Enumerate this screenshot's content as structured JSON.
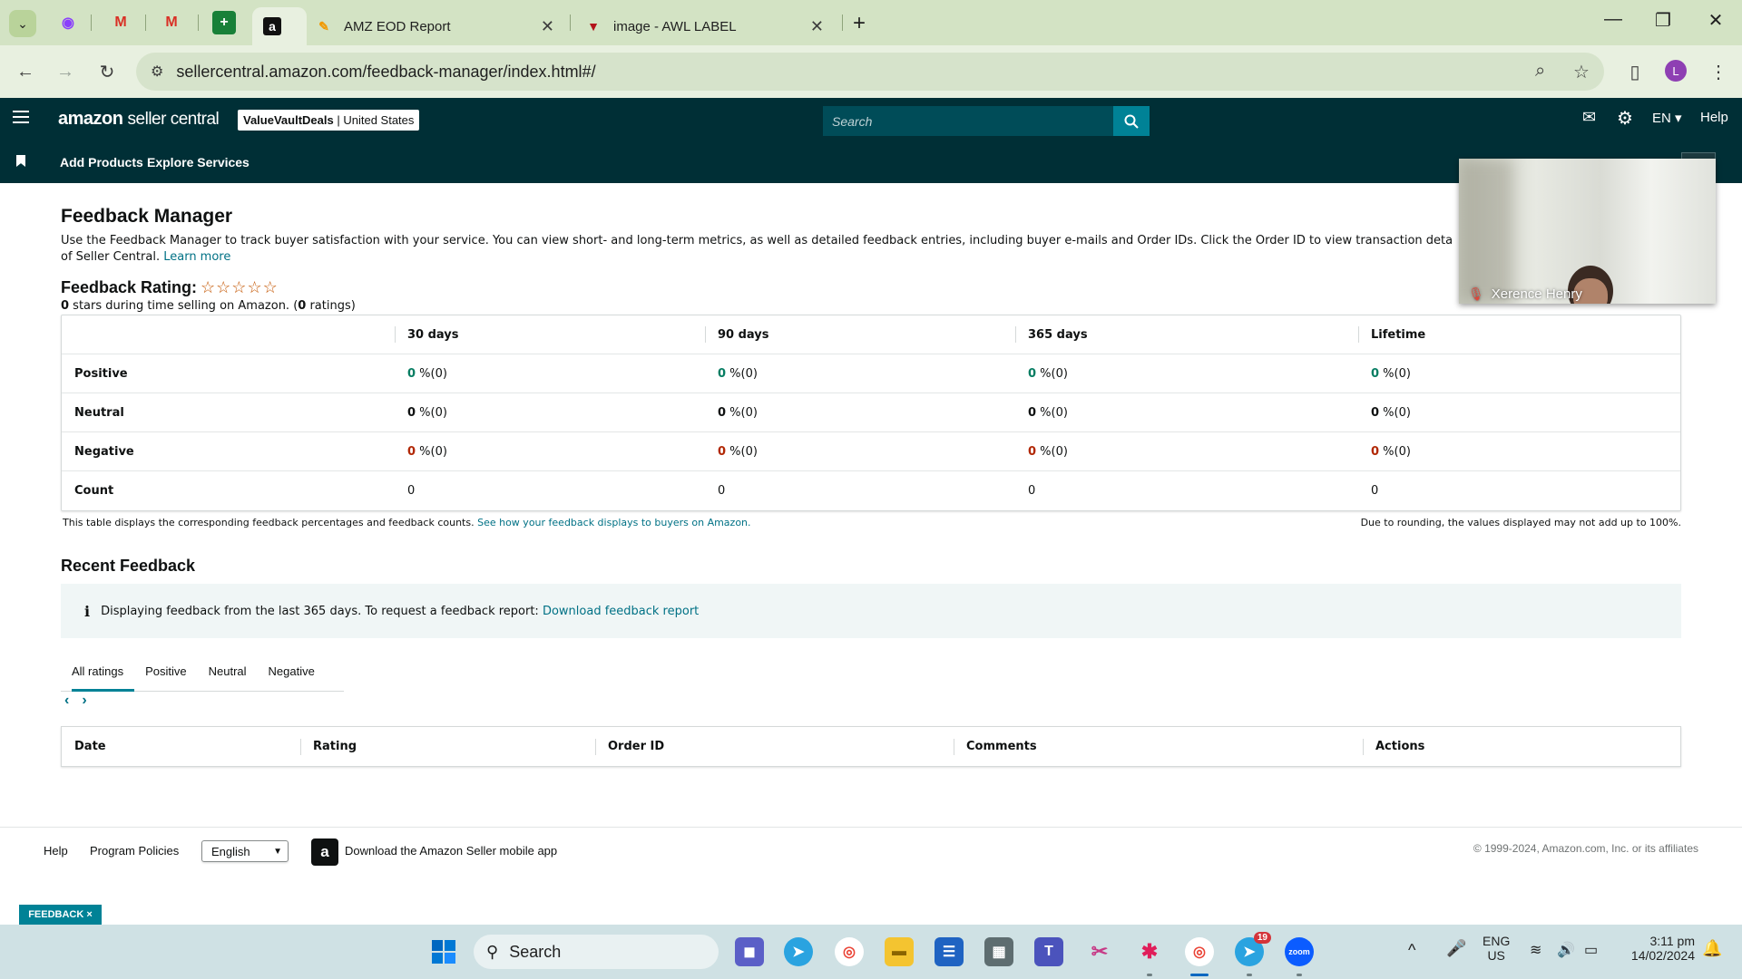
{
  "browser": {
    "tabs": [
      {
        "title": "AMZ EOD Report"
      },
      {
        "title": "image - AWL LABEL"
      }
    ],
    "url": "sellercentral.amazon.com/feedback-manager/index.html#/",
    "profile_initial": "L"
  },
  "header": {
    "logo_main": "amazon",
    "logo_sub": "seller central",
    "store_name": "ValueVaultDeals",
    "store_region": "United States",
    "search_placeholder": "Search",
    "language": "EN",
    "help": "Help",
    "nav": [
      "Add Products",
      "Explore Services"
    ]
  },
  "page": {
    "title": "Feedback Manager",
    "description": "Use the Feedback Manager to track buyer satisfaction with your service. You can view short- and long-term metrics, as well as detailed feedback entries, including buyer e-mails and Order IDs. Click the Order ID to view transaction deta",
    "description_line2": "of Seller Central.",
    "learn_more": "Learn more",
    "rating_label": "Feedback Rating:",
    "stars": "☆☆☆☆☆",
    "stars_value": "0",
    "stars_text": " stars during time selling on Amazon. (",
    "ratings_count": "0",
    "ratings_text": " ratings)"
  },
  "feedback_table": {
    "columns": [
      "30 days",
      "90 days",
      "365 days",
      "Lifetime"
    ],
    "rows": [
      {
        "label": "Positive",
        "values": [
          "0",
          "0",
          "0",
          "0"
        ],
        "suffix": " %(0)"
      },
      {
        "label": "Neutral",
        "values": [
          "0",
          "0",
          "0",
          "0"
        ],
        "suffix": " %(0)"
      },
      {
        "label": "Negative",
        "values": [
          "0",
          "0",
          "0",
          "0"
        ],
        "suffix": " %(0)"
      },
      {
        "label": "Count",
        "values": [
          "0",
          "0",
          "0",
          "0"
        ],
        "suffix": ""
      }
    ],
    "note_left": "This table displays the corresponding feedback percentages and feedback counts.",
    "note_link": "See how your feedback displays to buyers on Amazon.",
    "note_right": "Due to rounding, the values displayed may not add up to 100%."
  },
  "recent": {
    "title": "Recent Feedback",
    "info": "Displaying feedback from the last 365 days. To request a feedback report:",
    "info_link": "Download feedback report",
    "tabs": [
      "All ratings",
      "Positive",
      "Neutral",
      "Negative"
    ],
    "active_tab": "All ratings",
    "columns": [
      "Date",
      "Rating",
      "Order ID",
      "Comments",
      "Actions"
    ]
  },
  "footer": {
    "help": "Help",
    "policies": "Program Policies",
    "language": "English",
    "app_text": "Download the Amazon Seller mobile app",
    "copyright": "© 1999-2024, Amazon.com, Inc. or its affiliates",
    "feedback_tag": "FEEDBACK ×"
  },
  "video": {
    "participant": "Xerence Henry"
  },
  "taskbar": {
    "search": "Search",
    "lang_top": "ENG",
    "lang_bottom": "US",
    "time": "3:11 pm",
    "date": "14/02/2024",
    "telegram_badge": "19"
  }
}
